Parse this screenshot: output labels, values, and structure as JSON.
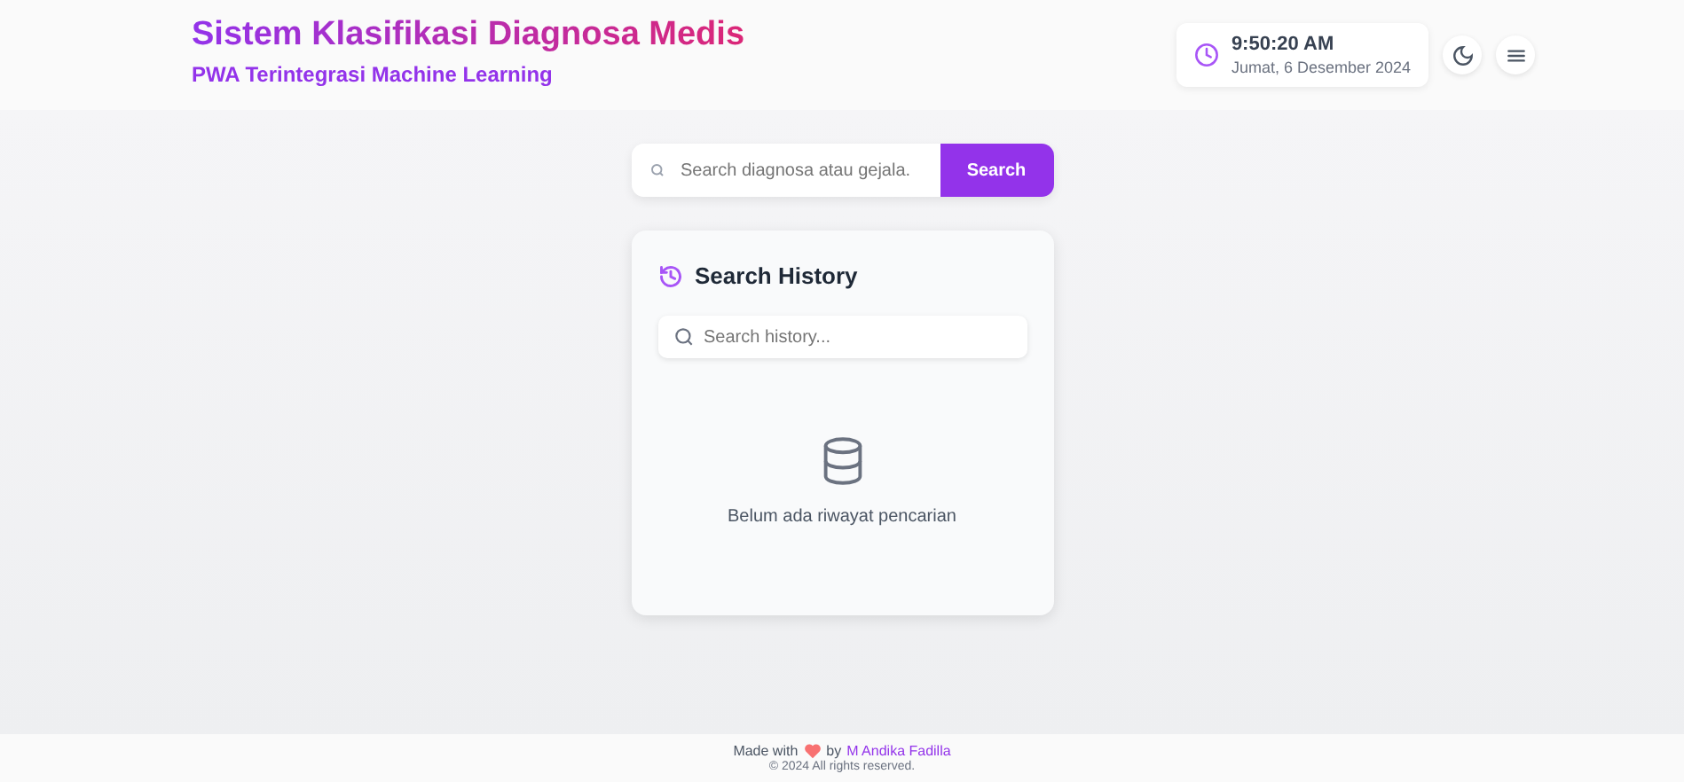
{
  "header": {
    "title": "Sistem Klasifikasi Diagnosa Medis",
    "subtitle": "PWA Terintegrasi Machine Learning",
    "clock": {
      "time": "9:50:20 AM",
      "date": "Jumat, 6 Desember 2024"
    }
  },
  "search": {
    "placeholder": "Search diagnosa atau gejala.",
    "button": "Search"
  },
  "history": {
    "title": "Search History",
    "search_placeholder": "Search history...",
    "empty_message": "Belum ada riwayat pencarian"
  },
  "footer": {
    "made_with": "Made with",
    "by": "by",
    "author": "M Andika Fadilla",
    "copyright": "© 2024 All rights reserved."
  }
}
